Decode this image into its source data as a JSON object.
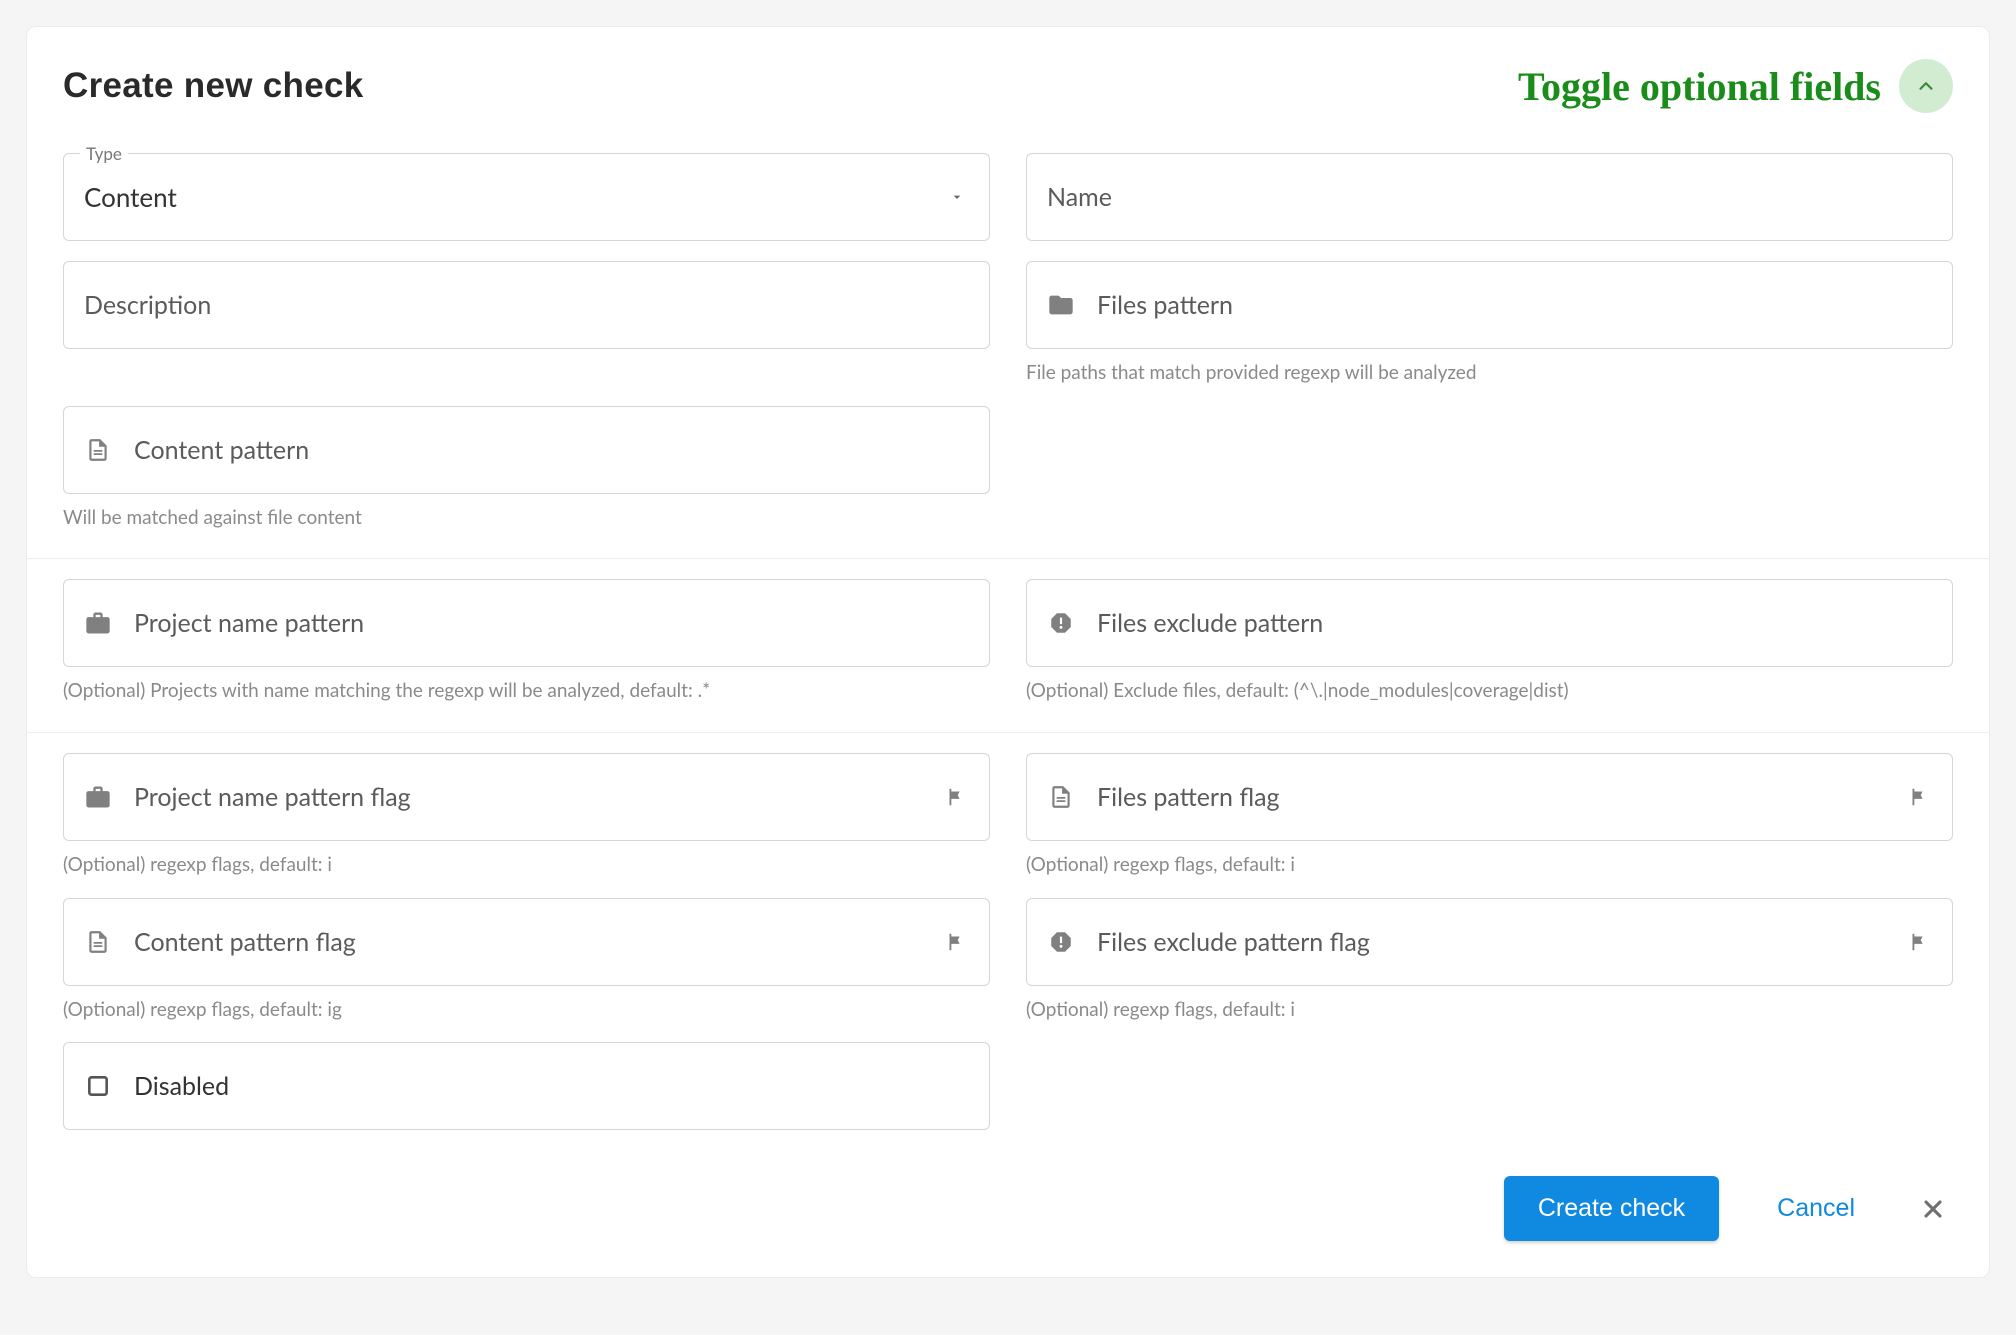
{
  "header": {
    "title": "Create new check",
    "toggle_label": "Toggle optional fields"
  },
  "fields": {
    "type": {
      "floating_label": "Type",
      "value": "Content"
    },
    "name": {
      "placeholder": "Name"
    },
    "description": {
      "placeholder": "Description"
    },
    "files_pattern": {
      "placeholder": "Files pattern",
      "helper": "File paths that match provided regexp will be analyzed"
    },
    "content_pattern": {
      "placeholder": "Content pattern",
      "helper": "Will be matched against file content"
    },
    "project_name_pattern": {
      "placeholder": "Project name pattern",
      "helper": "(Optional) Projects with name matching the regexp will be analyzed, default: .*"
    },
    "files_exclude_pattern": {
      "placeholder": "Files exclude pattern",
      "helper": "(Optional) Exclude files, default: (^\\.|node_modules|coverage|dist)"
    },
    "project_name_pattern_flag": {
      "placeholder": "Project name pattern flag",
      "helper": "(Optional) regexp flags, default: i"
    },
    "files_pattern_flag": {
      "placeholder": "Files pattern flag",
      "helper": "(Optional) regexp flags, default: i"
    },
    "content_pattern_flag": {
      "placeholder": "Content pattern flag",
      "helper": "(Optional) regexp flags, default: ig"
    },
    "files_exclude_pattern_flag": {
      "placeholder": "Files exclude pattern flag",
      "helper": "(Optional) regexp flags, default: i"
    },
    "disabled": {
      "label": "Disabled",
      "checked": false
    }
  },
  "actions": {
    "submit": "Create check",
    "cancel": "Cancel"
  }
}
